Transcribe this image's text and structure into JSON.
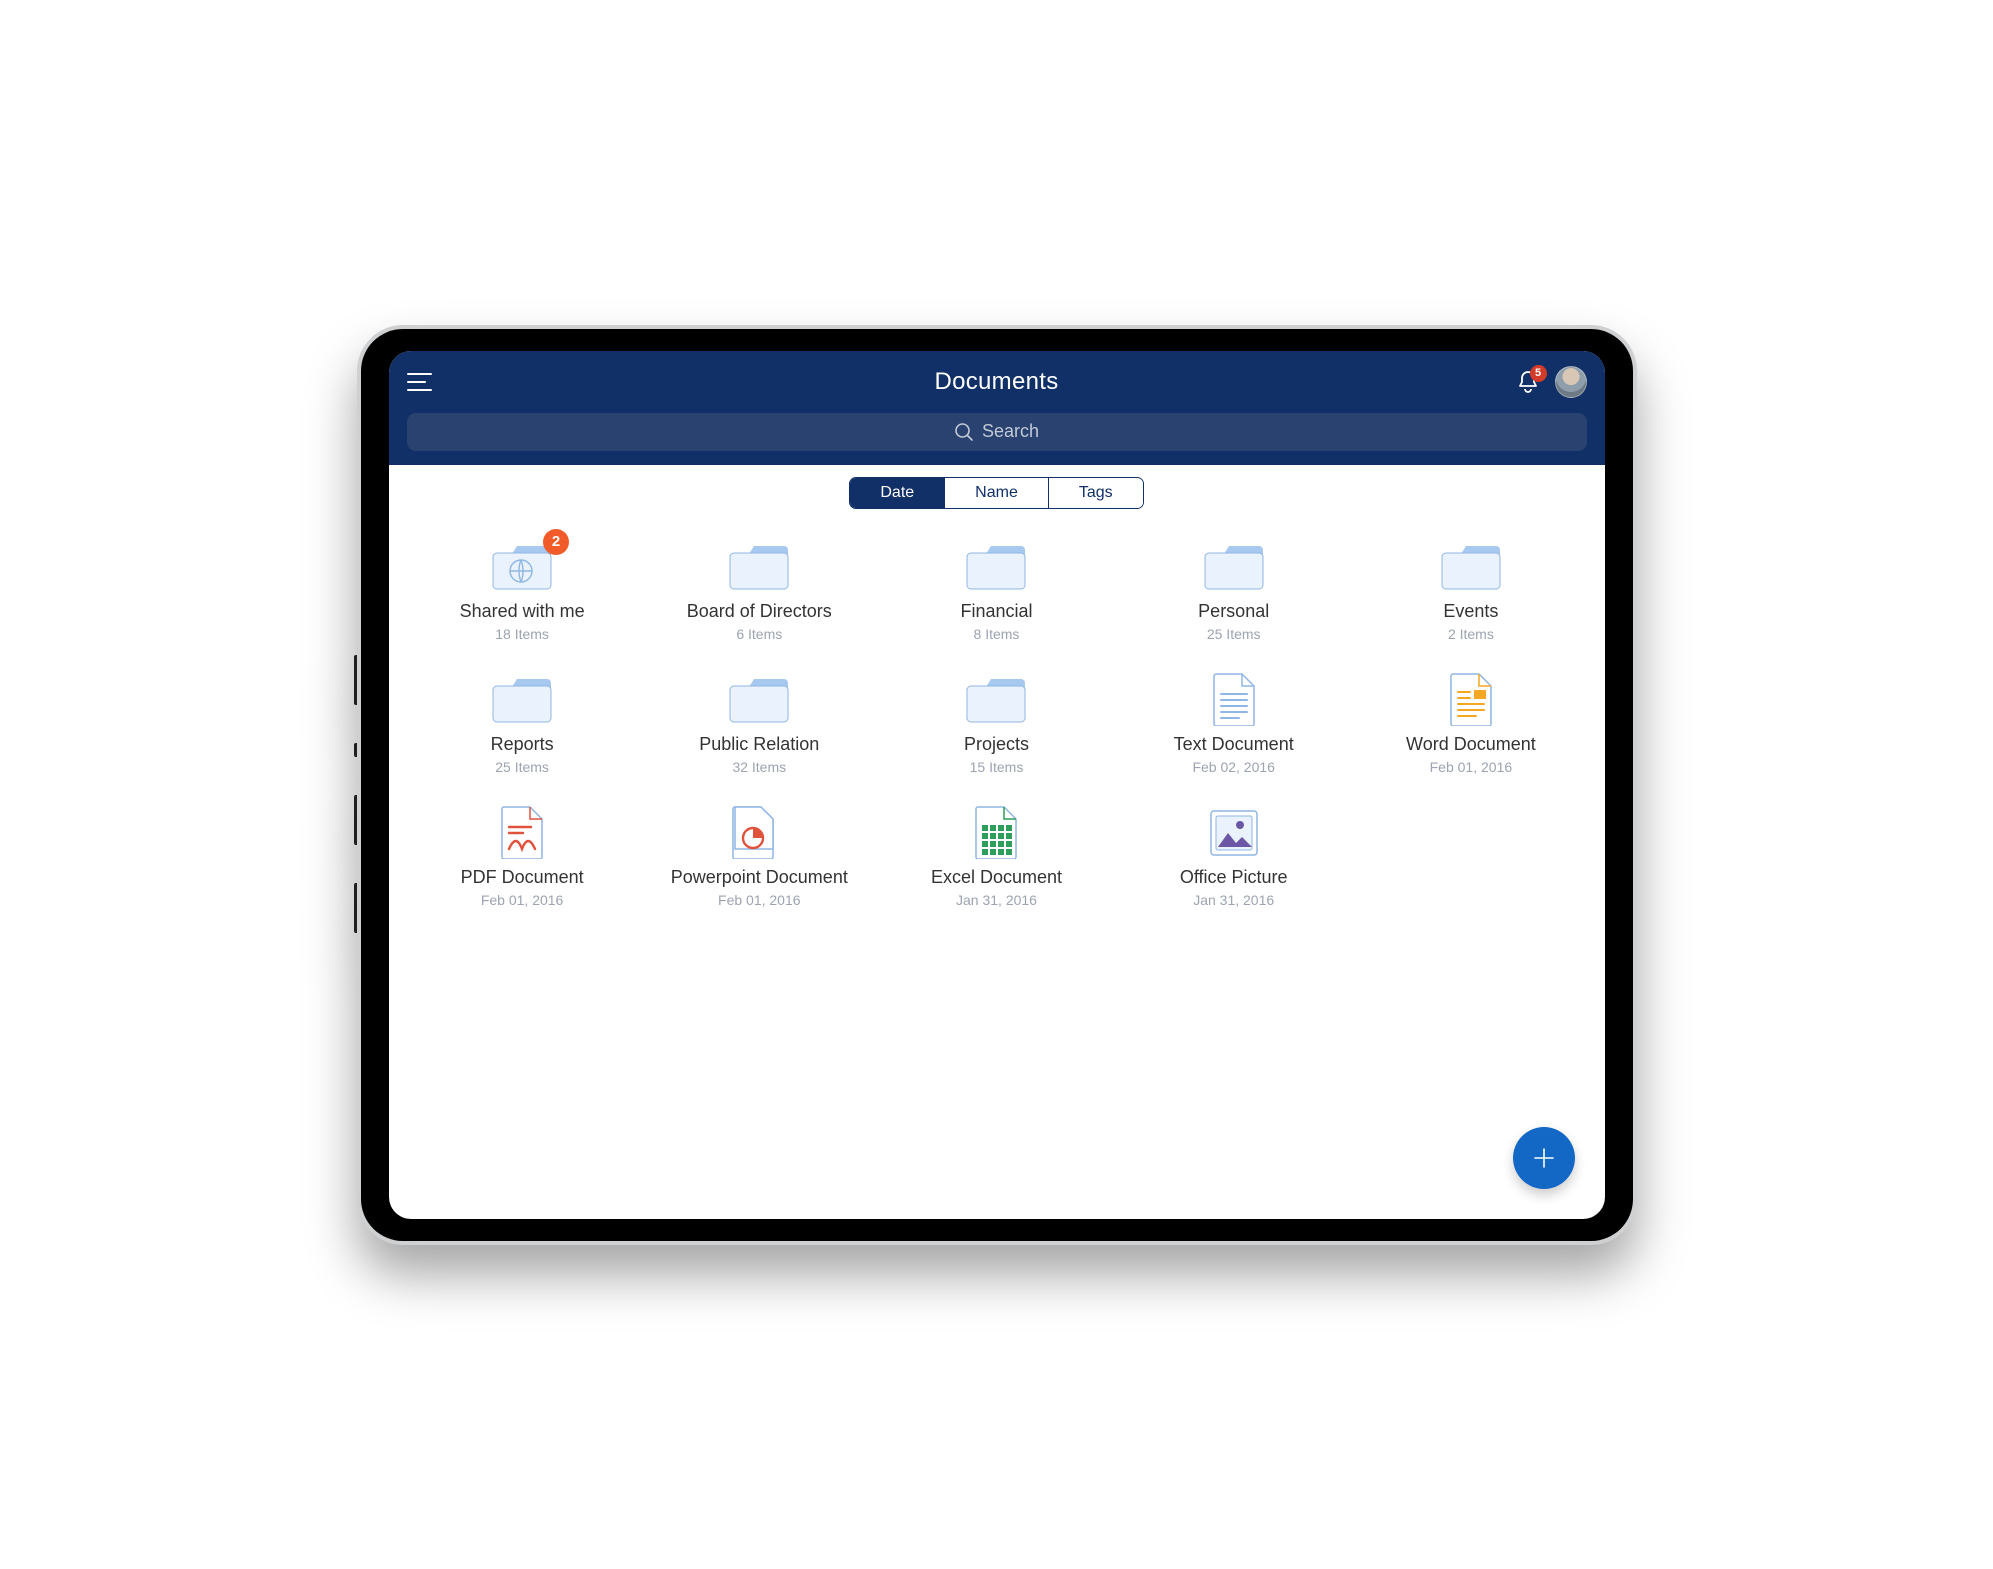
{
  "header": {
    "title": "Documents",
    "notification_count": "5",
    "search_placeholder": "Search"
  },
  "sort": {
    "options": [
      "Date",
      "Name",
      "Tags"
    ],
    "active": "Date"
  },
  "items": [
    {
      "id": "shared",
      "kind": "folder-shared",
      "name": "Shared with me",
      "sub": "18 Items",
      "badge": "2"
    },
    {
      "id": "board",
      "kind": "folder",
      "name": "Board of Directors",
      "sub": "6 Items"
    },
    {
      "id": "financial",
      "kind": "folder",
      "name": "Financial",
      "sub": "8 Items"
    },
    {
      "id": "personal",
      "kind": "folder",
      "name": "Personal",
      "sub": "25 Items"
    },
    {
      "id": "events",
      "kind": "folder",
      "name": "Events",
      "sub": "2 Items"
    },
    {
      "id": "reports",
      "kind": "folder",
      "name": "Reports",
      "sub": "25 Items"
    },
    {
      "id": "pr",
      "kind": "folder",
      "name": "Public Relation",
      "sub": "32 Items"
    },
    {
      "id": "projects",
      "kind": "folder",
      "name": "Projects",
      "sub": "15 Items"
    },
    {
      "id": "text",
      "kind": "file-text",
      "name": "Text Document",
      "sub": "Feb 02, 2016"
    },
    {
      "id": "word",
      "kind": "file-word",
      "name": "Word Document",
      "sub": "Feb 01, 2016"
    },
    {
      "id": "pdf",
      "kind": "file-pdf",
      "name": "PDF Document",
      "sub": "Feb 01, 2016"
    },
    {
      "id": "ppt",
      "kind": "file-ppt",
      "name": "Powerpoint Document",
      "sub": "Feb 01, 2016"
    },
    {
      "id": "xls",
      "kind": "file-xls",
      "name": "Excel Document",
      "sub": "Jan 31, 2016"
    },
    {
      "id": "img",
      "kind": "file-image",
      "name": "Office Picture",
      "sub": "Jan 31, 2016"
    }
  ],
  "colors": {
    "brand": "#113067",
    "accent": "#1368c6",
    "badge": "#f15a29"
  }
}
